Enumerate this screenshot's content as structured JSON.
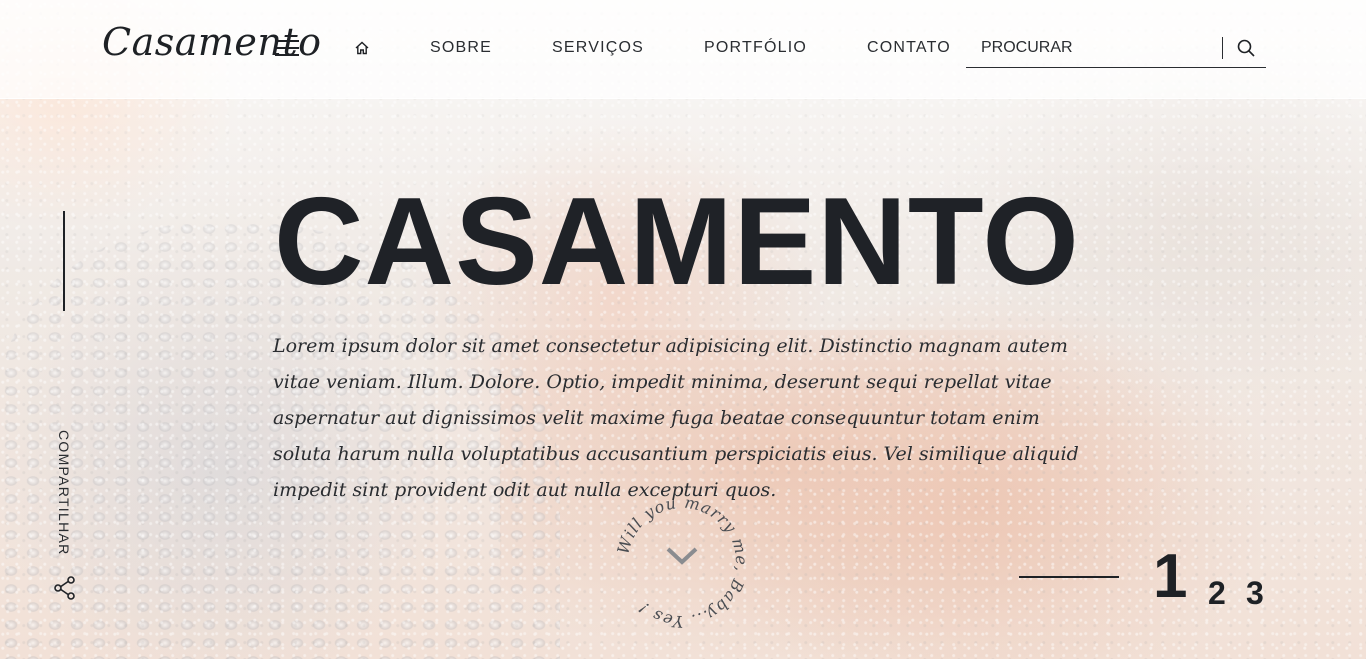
{
  "brand": {
    "logo": "Casamento"
  },
  "nav": {
    "home_icon": "home-icon",
    "items": [
      {
        "label": "SOBRE"
      },
      {
        "label": "SERVIÇOS"
      },
      {
        "label": "PORTFÓLIO"
      },
      {
        "label": "CONTATO"
      }
    ]
  },
  "search": {
    "placeholder": "PROCURAR",
    "value": "",
    "icon": "search-icon"
  },
  "share": {
    "label": "COMPARTILHAR",
    "icon": "share-icon"
  },
  "hero": {
    "title": "CASAMENTO",
    "text": "Lorem ipsum dolor sit amet consectetur adipisicing elit. Distinctio magnam autem vitae veniam. Illum. Dolore. Optio, impedit minima, deserunt sequi repellat vitae aspernatur aut dignissimos velit maxime fuga beatae consequuntur totam enim soluta harum nulla voluptatibus accusantium perspiciatis eius. Vel similique aliquid impedit sint provident odit aut nulla excepturi quos."
  },
  "badge": {
    "circle_text": "Will you marry me, Baby... Yes !",
    "icon": "chevron-down-icon"
  },
  "pager": {
    "current": "1",
    "pages": [
      "2",
      "3"
    ]
  },
  "colors": {
    "text": "#1e2125",
    "header_bg": "rgba(255,255,255,0.72)"
  }
}
